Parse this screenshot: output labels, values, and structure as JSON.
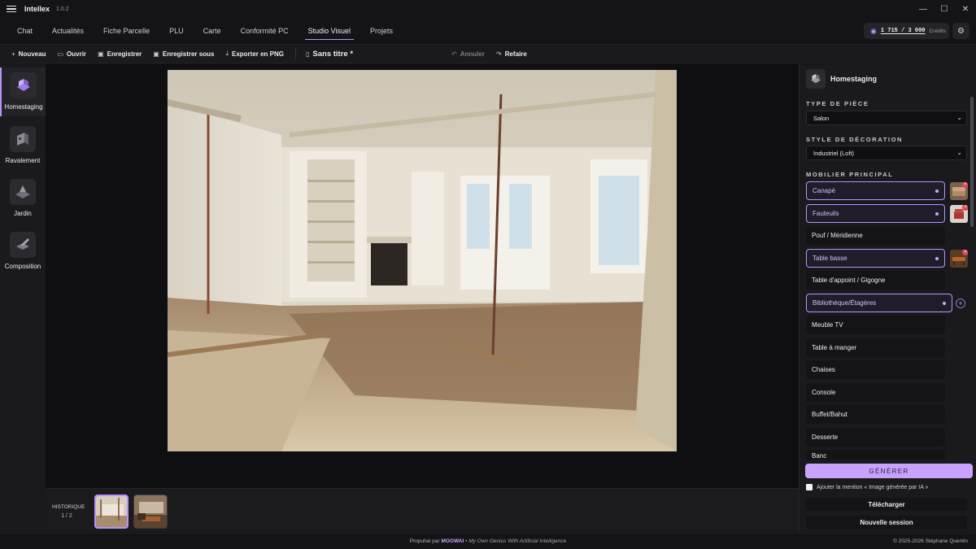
{
  "app": {
    "name": "Intellex",
    "version": "1.0.2"
  },
  "window_controls": {
    "minimize": "—",
    "maximize": "☐",
    "close": "✕"
  },
  "tabs": [
    {
      "label": "Chat"
    },
    {
      "label": "Actualités"
    },
    {
      "label": "Fiche Parcelle"
    },
    {
      "label": "PLU"
    },
    {
      "label": "Carte"
    },
    {
      "label": "Conformité PC"
    },
    {
      "label": "Studio Visuel",
      "active": true
    },
    {
      "label": "Projets"
    }
  ],
  "credits": {
    "value": "1 715 / 3 000",
    "label": "Crédits"
  },
  "toolbar": {
    "new": "Nouveau",
    "open": "Ouvrir",
    "save": "Enregistrer",
    "save_as": "Enregistrer sous",
    "export": "Exporter en PNG",
    "document": "Sans titre *",
    "undo": "Annuler",
    "redo": "Refaire"
  },
  "sidebar": {
    "items": [
      {
        "label": "Homestaging",
        "active": true
      },
      {
        "label": "Ravalement"
      },
      {
        "label": "Jardin"
      },
      {
        "label": "Composition"
      }
    ]
  },
  "history": {
    "label": "HISTORIQUE",
    "count": "1 / 2"
  },
  "panel": {
    "title": "Homestaging",
    "room_type_label": "TYPE DE PIÈCE",
    "room_type": "Salon",
    "style_label": "STYLE DE DÉCORATION",
    "style": "Industriel (Loft)",
    "furniture_label": "MOBILIER PRINCIPAL",
    "furniture": [
      {
        "label": "Canapé",
        "selected": true
      },
      {
        "label": "Fauteuils",
        "selected": true
      },
      {
        "label": "Pouf / Méridienne"
      },
      {
        "label": "Table basse",
        "selected": true
      },
      {
        "label": "Table d'appoint / Gigogne"
      },
      {
        "label": "Bibliothèque/Étagères",
        "selected": true
      },
      {
        "label": "Meuble TV"
      },
      {
        "label": "Table à manger"
      },
      {
        "label": "Chaises"
      },
      {
        "label": "Console"
      },
      {
        "label": "Buffet/Bahut"
      },
      {
        "label": "Desserte"
      },
      {
        "label": "Banc"
      }
    ],
    "generate": "GÉNÉRER",
    "ai_mention": "Ajouter la mention « Image générée par IA »",
    "download": "Télécharger",
    "new_session": "Nouvelle session"
  },
  "footer": {
    "powered": "Propulsé par",
    "brand": "MOGWAI",
    "sep": "•",
    "motto": "My Own Genius With Artificial Intelligence",
    "copyright": "© 2025-2026 Stéphane Quentin"
  },
  "colors": {
    "accent": "#b693ff",
    "background": "#141416",
    "panel": "#1a1a1d",
    "generate": "#c8a2ff"
  }
}
